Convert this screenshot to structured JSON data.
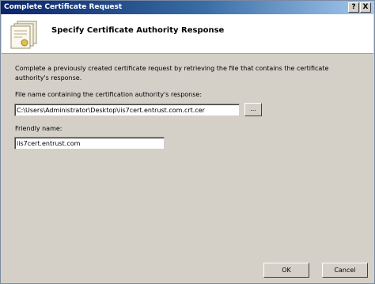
{
  "window": {
    "title": "Complete Certificate Request",
    "help_label": "?",
    "close_label": "X"
  },
  "header": {
    "title": "Specify Certificate Authority Response",
    "icon": "certificate-icon"
  },
  "description": "Complete a previously created certificate request by retrieving the file that contains the certificate authority's response.",
  "file_field": {
    "label": "File name containing the certification authority's response:",
    "value": "C:\\Users\\Administrator\\Desktop\\iis7cert.entrust.com.crt.cer",
    "browse_label": "..."
  },
  "friendly_field": {
    "label": "Friendly name:",
    "value": "iis7cert.entrust.com"
  },
  "buttons": {
    "ok": "OK",
    "cancel": "Cancel"
  }
}
